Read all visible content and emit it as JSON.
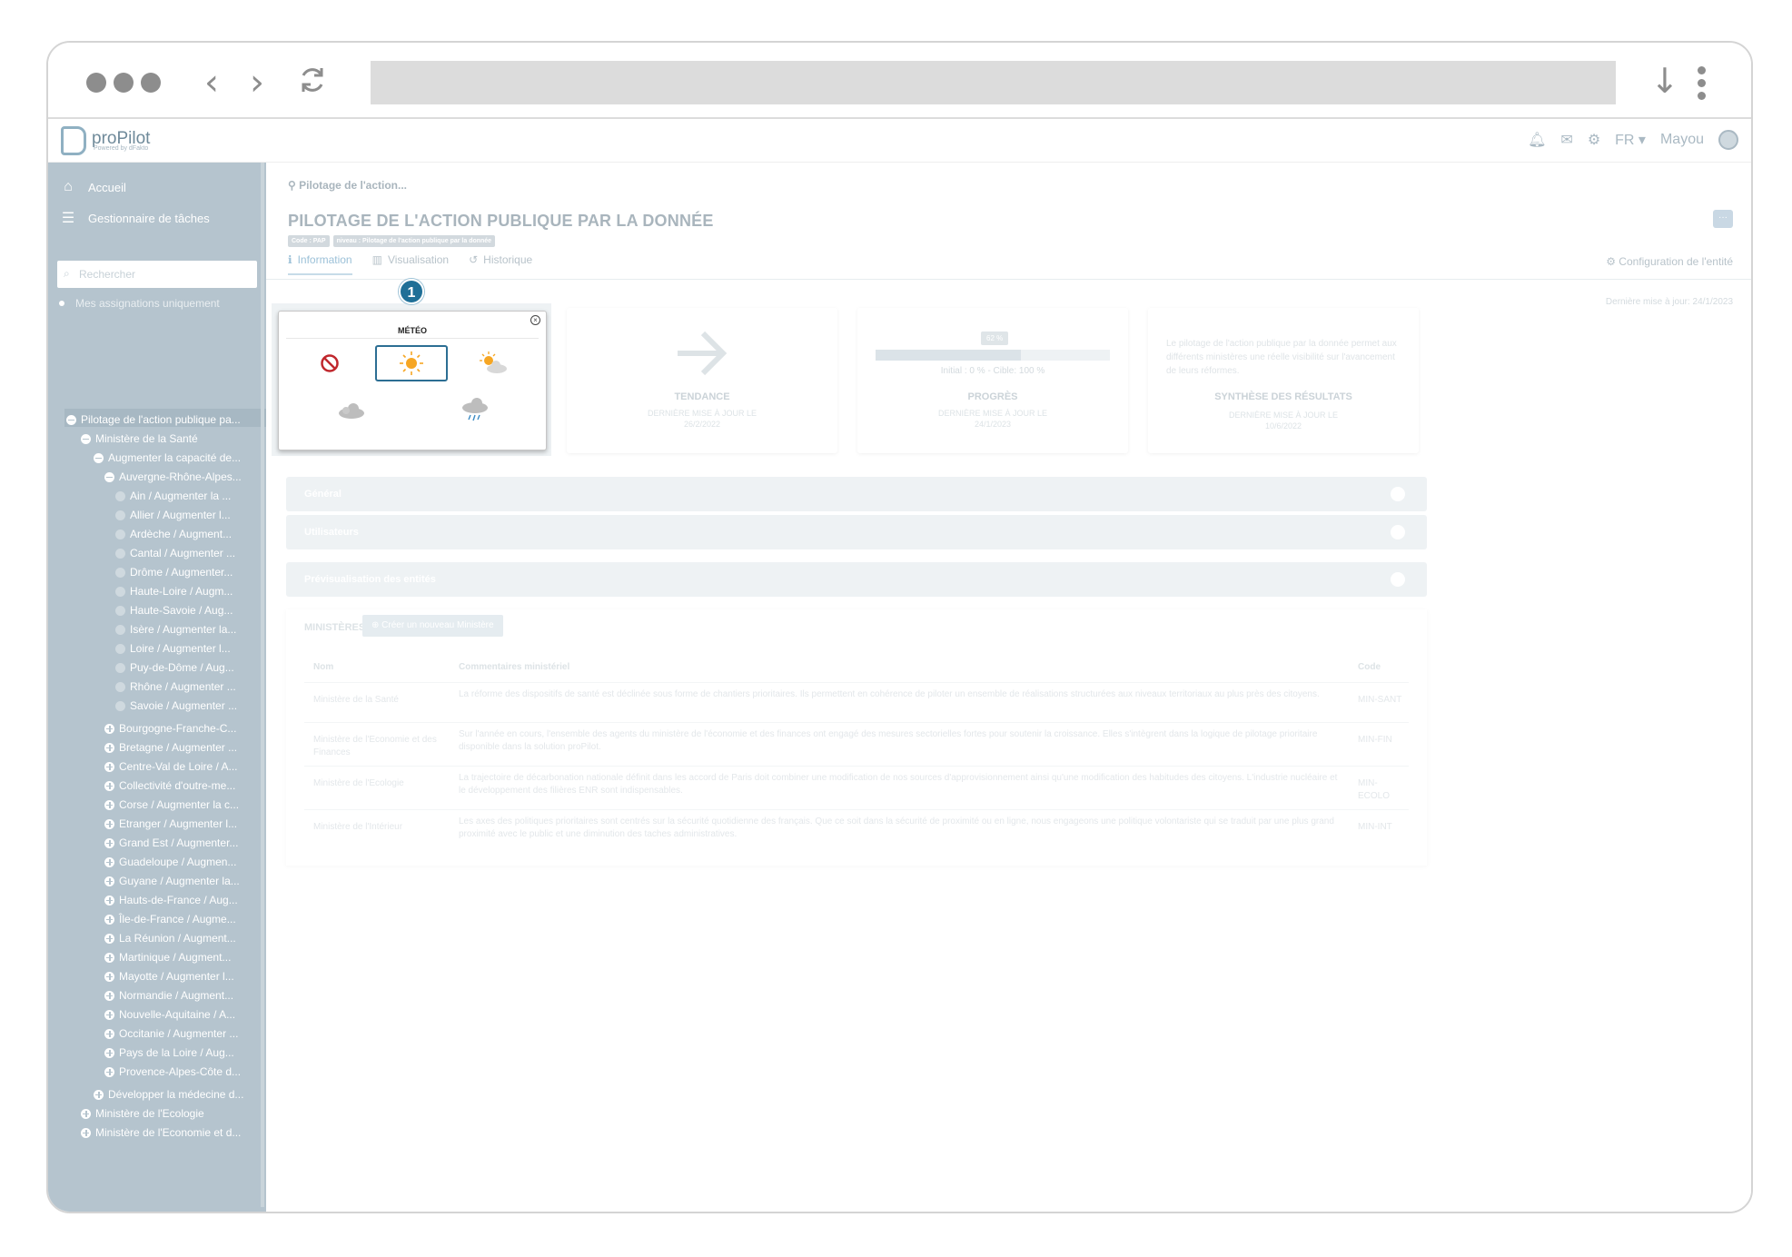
{
  "app": {
    "logo_name": "proPilot",
    "logo_sub": "Powered by dFakto",
    "lang": "FR",
    "user": "Mayou"
  },
  "sidebar": {
    "nav": [
      {
        "label": "Accueil",
        "icon": "home-icon"
      },
      {
        "label": "Gestionnaire de tâches",
        "icon": "task-list-icon"
      }
    ],
    "search_placeholder": "Rechercher",
    "assignments_label": "Mes assignations uniquement",
    "tree": [
      {
        "label": "Pilotage de l'action publique pa...",
        "level": 0,
        "type": "minus"
      },
      {
        "label": "Ministère de la Santé",
        "level": 1,
        "type": "minus"
      },
      {
        "label": "Augmenter la capacité de...",
        "level": 2,
        "type": "minus"
      },
      {
        "label": "Auvergne-Rhône-Alpes...",
        "level": 3,
        "type": "minus"
      },
      {
        "label": "Ain / Augmenter la ...",
        "level": 4,
        "type": "leaf"
      },
      {
        "label": "Allier / Augmenter l...",
        "level": 4,
        "type": "leaf"
      },
      {
        "label": "Ardèche / Augment...",
        "level": 4,
        "type": "leaf"
      },
      {
        "label": "Cantal / Augmenter ...",
        "level": 4,
        "type": "leaf"
      },
      {
        "label": "Drôme / Augmenter...",
        "level": 4,
        "type": "leaf"
      },
      {
        "label": "Haute-Loire / Augm...",
        "level": 4,
        "type": "leaf"
      },
      {
        "label": "Haute-Savoie / Aug...",
        "level": 4,
        "type": "leaf"
      },
      {
        "label": "Isère / Augmenter la...",
        "level": 4,
        "type": "leaf"
      },
      {
        "label": "Loire / Augmenter l...",
        "level": 4,
        "type": "leaf"
      },
      {
        "label": "Puy-de-Dôme / Aug...",
        "level": 4,
        "type": "leaf"
      },
      {
        "label": "Rhône / Augmenter ...",
        "level": 4,
        "type": "leaf"
      },
      {
        "label": "Savoie / Augmenter ...",
        "level": 4,
        "type": "leaf"
      },
      {
        "label": "Bourgogne-Franche-C...",
        "level": 3,
        "type": "plus"
      },
      {
        "label": "Bretagne / Augmenter ...",
        "level": 3,
        "type": "plus"
      },
      {
        "label": "Centre-Val de Loire / A...",
        "level": 3,
        "type": "plus"
      },
      {
        "label": "Collectivité d'outre-me...",
        "level": 3,
        "type": "plus"
      },
      {
        "label": "Corse / Augmenter la c...",
        "level": 3,
        "type": "plus"
      },
      {
        "label": "Etranger / Augmenter l...",
        "level": 3,
        "type": "plus"
      },
      {
        "label": "Grand Est / Augmenter...",
        "level": 3,
        "type": "plus"
      },
      {
        "label": "Guadeloupe / Augmen...",
        "level": 3,
        "type": "plus"
      },
      {
        "label": "Guyane / Augmenter la...",
        "level": 3,
        "type": "plus"
      },
      {
        "label": "Hauts-de-France / Aug...",
        "level": 3,
        "type": "plus"
      },
      {
        "label": "Île-de-France / Augme...",
        "level": 3,
        "type": "plus"
      },
      {
        "label": "La Réunion / Augment...",
        "level": 3,
        "type": "plus"
      },
      {
        "label": "Martinique / Augment...",
        "level": 3,
        "type": "plus"
      },
      {
        "label": "Mayotte / Augmenter l...",
        "level": 3,
        "type": "plus"
      },
      {
        "label": "Normandie / Augment...",
        "level": 3,
        "type": "plus"
      },
      {
        "label": "Nouvelle-Aquitaine / A...",
        "level": 3,
        "type": "plus"
      },
      {
        "label": "Occitanie / Augmenter ...",
        "level": 3,
        "type": "plus"
      },
      {
        "label": "Pays de la Loire / Aug...",
        "level": 3,
        "type": "plus"
      },
      {
        "label": "Provence-Alpes-Côte d...",
        "level": 3,
        "type": "plus"
      },
      {
        "label": "Développer la médecine d...",
        "level": 2,
        "type": "plus"
      },
      {
        "label": "Ministère de l'Ecologie",
        "level": 1,
        "type": "plus"
      },
      {
        "label": "Ministère de l'Economie et d...",
        "level": 1,
        "type": "plus"
      }
    ]
  },
  "main": {
    "breadcrumb": "Pilotage de l'action...",
    "title": "PILOTAGE DE L'ACTION PUBLIQUE PAR LA DONNÉE",
    "chips": [
      "Code : PAP",
      "niveau : Pilotage de l'action publique par la donnée"
    ],
    "more_label": "···",
    "tabs": [
      {
        "label": "Information",
        "icon": "info-icon",
        "glyph": "ℹ",
        "active": true
      },
      {
        "label": "Visualisation",
        "icon": "chart-icon",
        "glyph": "▥",
        "active": false
      },
      {
        "label": "Historique",
        "icon": "history-icon",
        "glyph": "↺",
        "active": false
      }
    ],
    "config_label": "Configuration de l'entité",
    "last_update": "Dernière mise à jour: 24/1/2023",
    "meteo": {
      "title": "MÉTÉO",
      "step": "1",
      "options": [
        "no-weather-icon",
        "sun-icon",
        "sun-cloud-icon",
        "cloud-icon",
        "rain-cloud-icon"
      ],
      "selected": "sun-icon"
    },
    "tendance": {
      "label": "TENDANCE",
      "sub1": "DERNIÈRE MISE À JOUR LE",
      "sub2": "26/2/2022"
    },
    "progres": {
      "label": "PROGRÈS",
      "badge": "62 %",
      "value": 0.62,
      "text": "Initial : 0 % - Cible: 100 %",
      "sub1": "DERNIÈRE MISE À JOUR LE",
      "sub2": "24/1/2023"
    },
    "synthese": {
      "text": "Le pilotage de l'action publique par la donnée permet aux différents ministères une réelle visibilité sur l'avancement de leurs réformes.",
      "label": "SYNTHÈSE DES RÉSULTATS",
      "sub1": "DERNIÈRE MISE À JOUR LE",
      "sub2": "10/6/2022"
    },
    "accordions": [
      "Général",
      "Utilisateurs",
      "Prévisualisation des entités"
    ],
    "table": {
      "section_label": "MINISTÈRES",
      "create_label": "Créer un nouveau Ministère",
      "headers": [
        "Nom",
        "Commentaires ministériel",
        "Code"
      ],
      "rows": [
        {
          "nom": "Ministère de la Santé",
          "comment": "La réforme des dispositifs de santé est déclinée sous forme de chantiers prioritaires. Ils permettent en cohérence de piloter un ensemble de réalisations structurées aux niveaux territoriaux au plus près des citoyens.",
          "code": "MIN-SANT"
        },
        {
          "nom": "Ministère de l'Economie et des Finances",
          "comment": "Sur l'année en cours, l'ensemble des agents du ministère de l'économie et des finances ont engagé des mesures sectorielles fortes pour soutenir la croissance. Elles s'intègrent dans la logique de pilotage prioritaire disponible dans la solution proPilot.",
          "code": "MIN-FIN"
        },
        {
          "nom": "Ministère de l'Ecologie",
          "comment": "La trajectoire de décarbonation nationale définit dans les accord de Paris doit combiner une modification de nos sources d'approvisionnement ainsi qu'une modification des habitudes des citoyens. L'industrie nucléaire et le développement des filières ENR sont indispensables.",
          "code": "MIN-ECOLO"
        },
        {
          "nom": "Ministère de l'Intérieur",
          "comment": "Les axes des politiques prioritaires sont centrés sur la sécurité quotidienne des français. Que ce soit dans la sécurité de proximité ou en ligne, nous engageons une politique volontariste qui se traduit par une plus grand proximité avec le public et une diminution des taches administratives.",
          "code": "MIN-INT"
        }
      ]
    }
  }
}
